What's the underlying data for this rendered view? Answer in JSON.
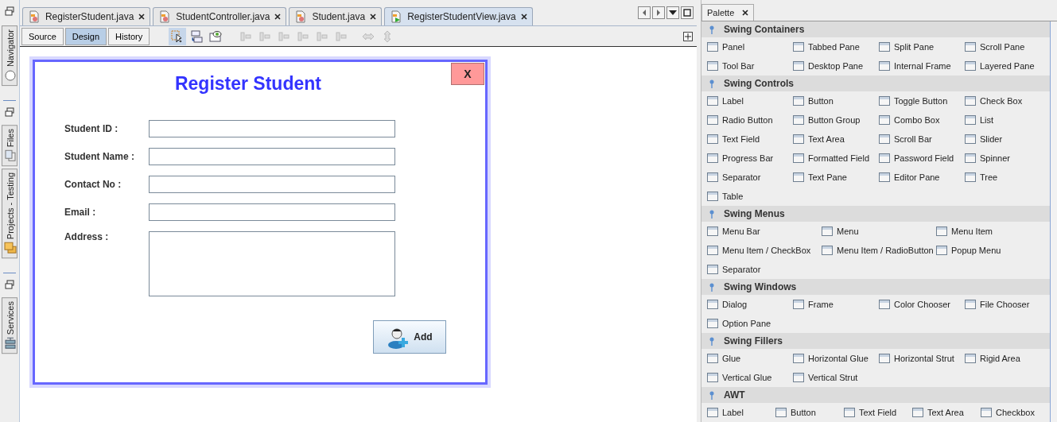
{
  "sidebar": {
    "tabs": [
      {
        "label": "Navigator",
        "kind": "navigator"
      },
      {
        "label": "Files",
        "kind": "files"
      },
      {
        "label": "Projects - Testing",
        "kind": "projects"
      },
      {
        "label": "Services",
        "kind": "services"
      }
    ]
  },
  "editor": {
    "tabs": [
      {
        "label": "RegisterStudent.java",
        "selected": false
      },
      {
        "label": "StudentController.java",
        "selected": false
      },
      {
        "label": "Student.java",
        "selected": false
      },
      {
        "label": "RegisterStudentView.java",
        "selected": true
      }
    ],
    "views": [
      {
        "label": "Source",
        "selected": false
      },
      {
        "label": "Design",
        "selected": true
      },
      {
        "label": "History",
        "selected": false
      }
    ]
  },
  "form": {
    "title": "Register Student",
    "close_label": "X",
    "fields": [
      {
        "label": "Student ID :",
        "kind": "text"
      },
      {
        "label": "Student Name :",
        "kind": "text"
      },
      {
        "label": "Contact No :",
        "kind": "text"
      },
      {
        "label": "Email :",
        "kind": "text"
      },
      {
        "label": "Address :",
        "kind": "textarea"
      }
    ],
    "submit_label": "Add"
  },
  "palette": {
    "title": "Palette",
    "sections": [
      {
        "title": "Swing Containers",
        "rows": [
          [
            "Panel",
            "Tabbed Pane",
            "Split Pane",
            "Scroll Pane"
          ],
          [
            "Tool Bar",
            "Desktop Pane",
            "Internal Frame",
            "Layered Pane"
          ]
        ]
      },
      {
        "title": "Swing Controls",
        "rows": [
          [
            "Label",
            "Button",
            "Toggle Button",
            "Check Box"
          ],
          [
            "Radio Button",
            "Button Group",
            "Combo Box",
            "List"
          ],
          [
            "Text Field",
            "Text Area",
            "Scroll Bar",
            "Slider"
          ],
          [
            "Progress Bar",
            "Formatted Field",
            "Password Field",
            "Spinner"
          ],
          [
            "Separator",
            "Text Pane",
            "Editor Pane",
            "Tree"
          ],
          [
            "Table"
          ]
        ]
      },
      {
        "title": "Swing Menus",
        "rows": [
          [
            "Menu Bar",
            "Menu",
            "Menu Item"
          ],
          [
            "Menu Item / CheckBox",
            "Menu Item / RadioButton",
            "Popup Menu"
          ],
          [
            "Separator"
          ]
        ]
      },
      {
        "title": "Swing Windows",
        "rows": [
          [
            "Dialog",
            "Frame",
            "Color Chooser",
            "File Chooser"
          ],
          [
            "Option Pane"
          ]
        ]
      },
      {
        "title": "Swing Fillers",
        "rows": [
          [
            "Glue",
            "Horizontal Glue",
            "Horizontal Strut",
            "Rigid Area"
          ],
          [
            "Vertical Glue",
            "Vertical Strut"
          ]
        ]
      },
      {
        "title": "AWT",
        "rows": [
          [
            "Label",
            "Button",
            "Text Field",
            "Text Area",
            "Checkbox"
          ]
        ]
      }
    ]
  }
}
